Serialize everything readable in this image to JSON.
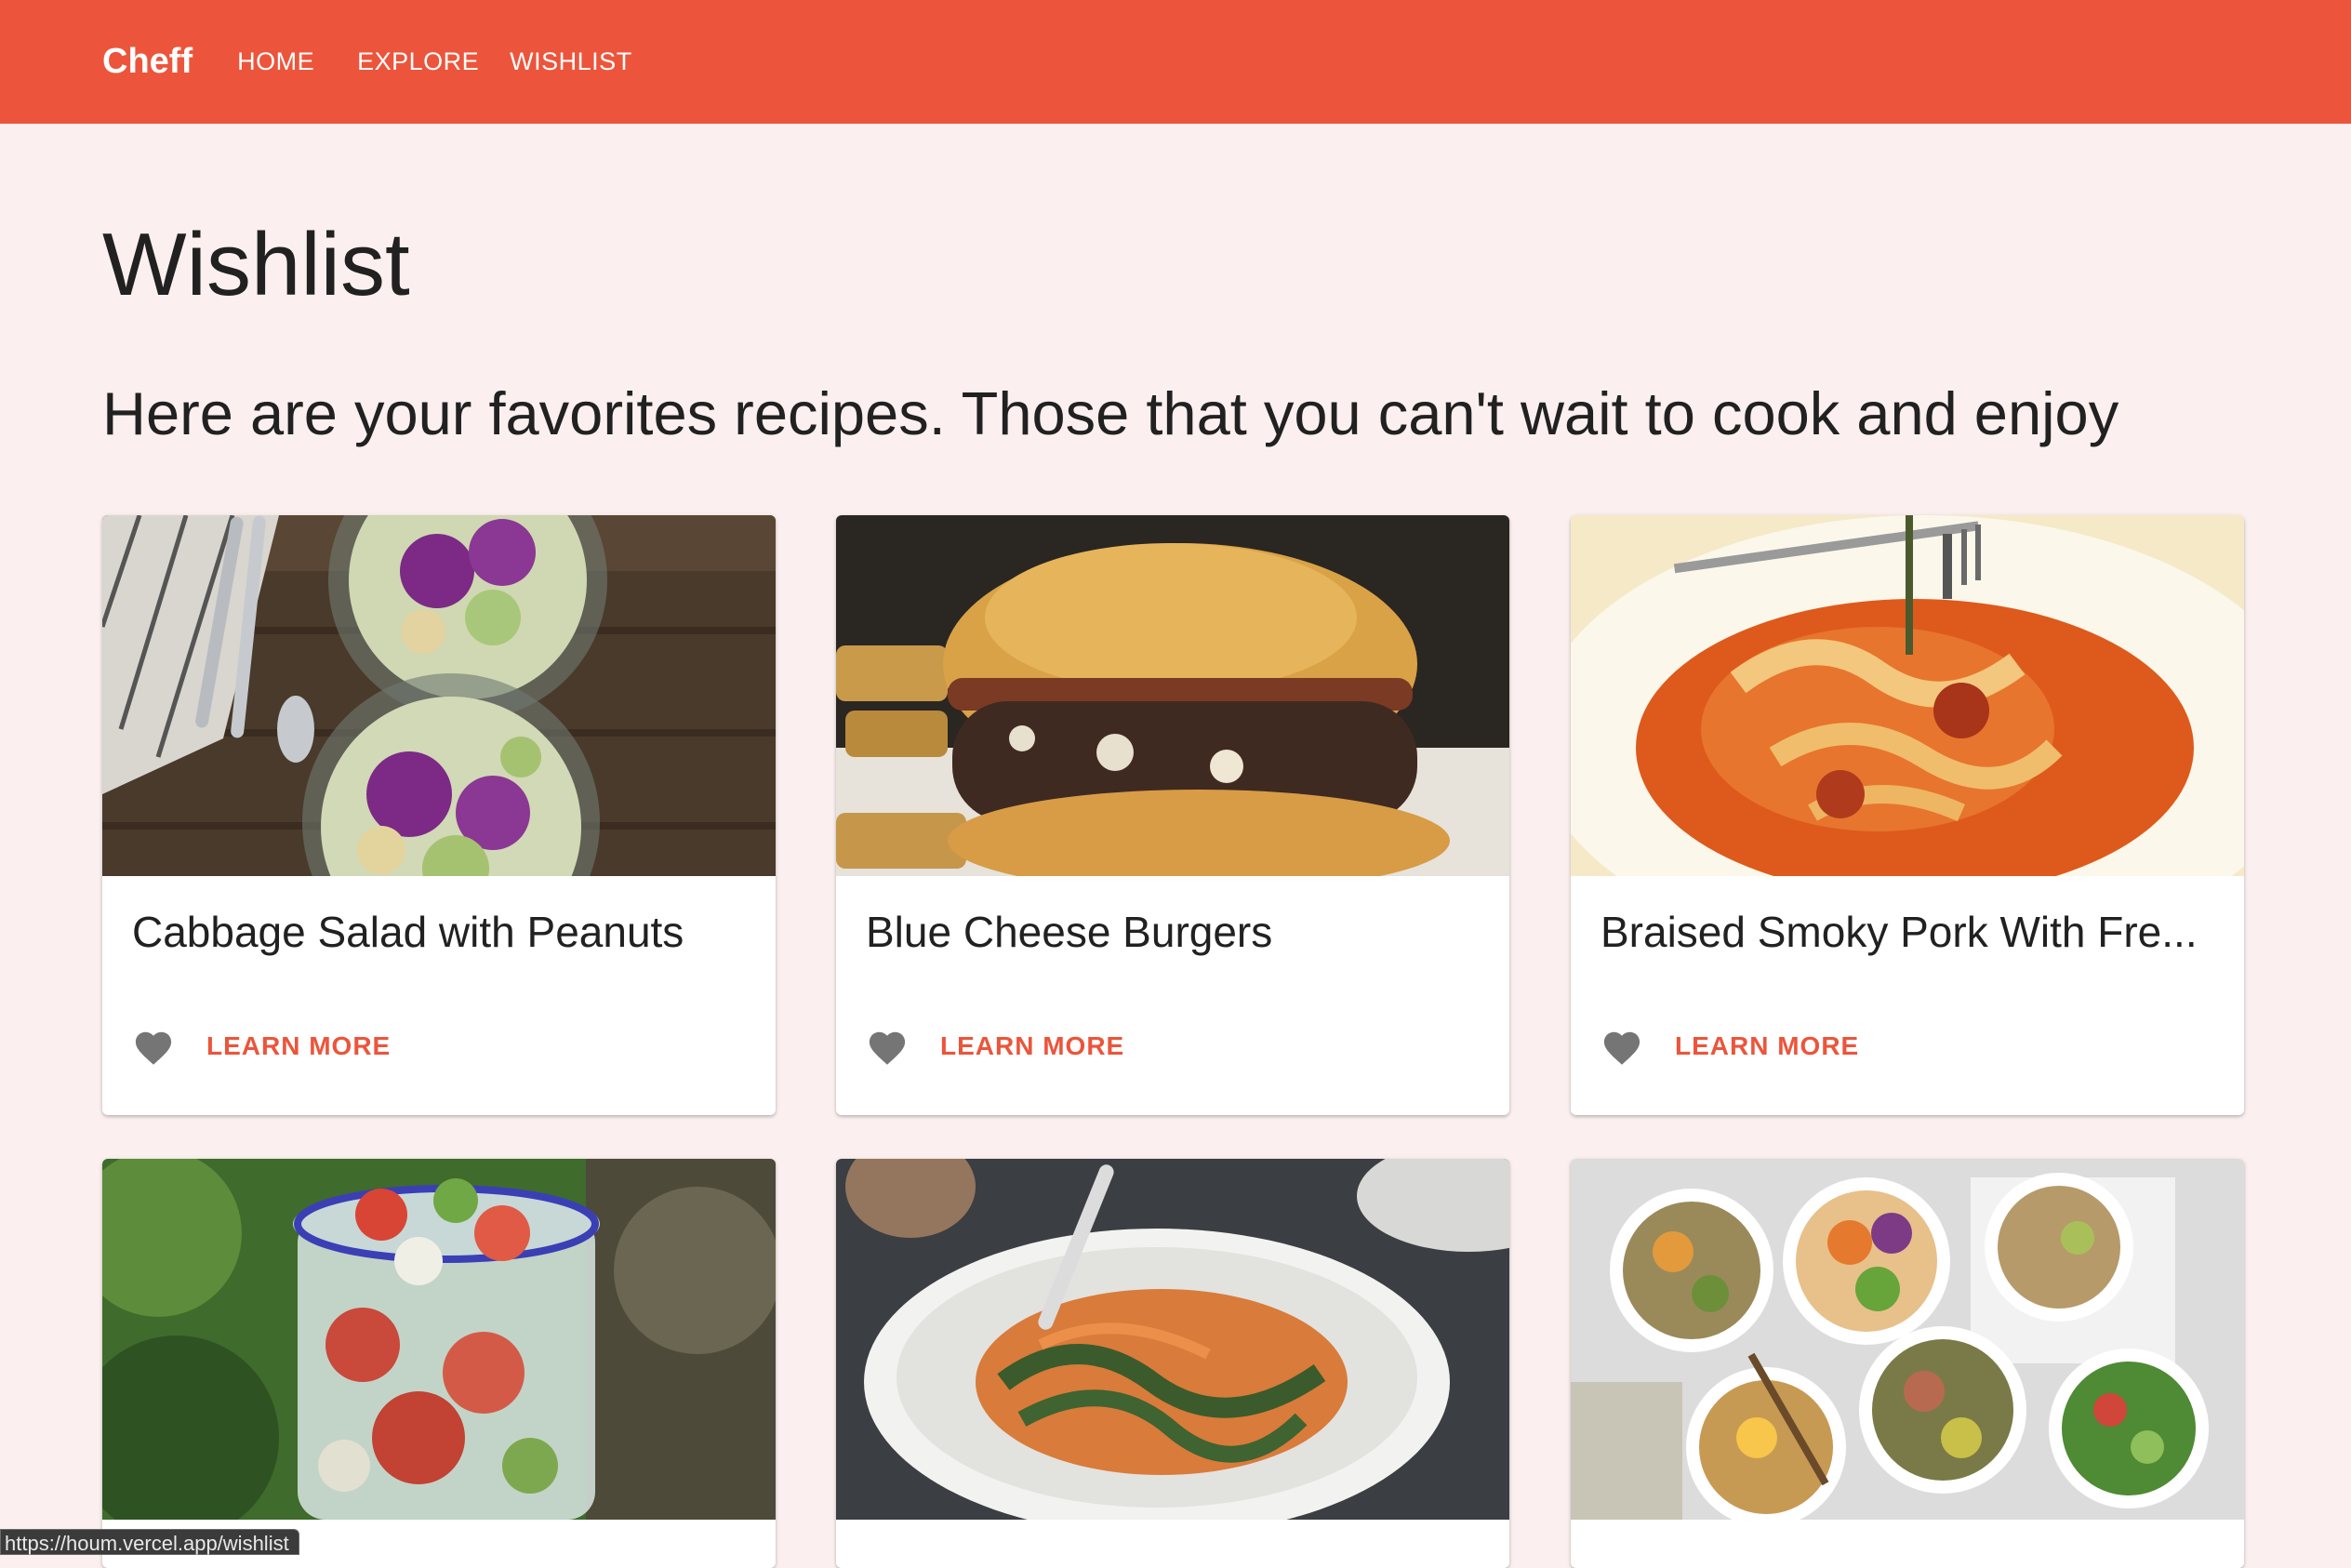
{
  "appbar": {
    "brand": "Cheff",
    "nav": [
      {
        "label": "HOME"
      },
      {
        "label": "EXPLORE"
      },
      {
        "label": "WISHLIST"
      }
    ],
    "color": "#EC553B"
  },
  "page": {
    "title": "Wishlist",
    "subtitle": "Here are your favorites recipes. Those that you can't wait to cook and enjoy",
    "background": "#FBF0EF"
  },
  "cards": [
    {
      "title": "Cabbage Salad with Peanuts",
      "action": "LEARN MORE",
      "favorite_icon": "heart-icon",
      "favorited": true
    },
    {
      "title": "Blue Cheese Burgers",
      "action": "LEARN MORE",
      "favorite_icon": "heart-icon",
      "favorited": true
    },
    {
      "title": "Braised Smoky Pork With Fre...",
      "action": "LEARN MORE",
      "favorite_icon": "heart-icon",
      "favorited": true
    },
    {
      "title": "",
      "action": "",
      "favorite_icon": "heart-icon"
    },
    {
      "title": "",
      "action": "",
      "favorite_icon": "heart-icon"
    },
    {
      "title": "",
      "action": "",
      "favorite_icon": "heart-icon"
    }
  ],
  "status_bar": {
    "url": "https://houm.vercel.app/wishlist"
  }
}
